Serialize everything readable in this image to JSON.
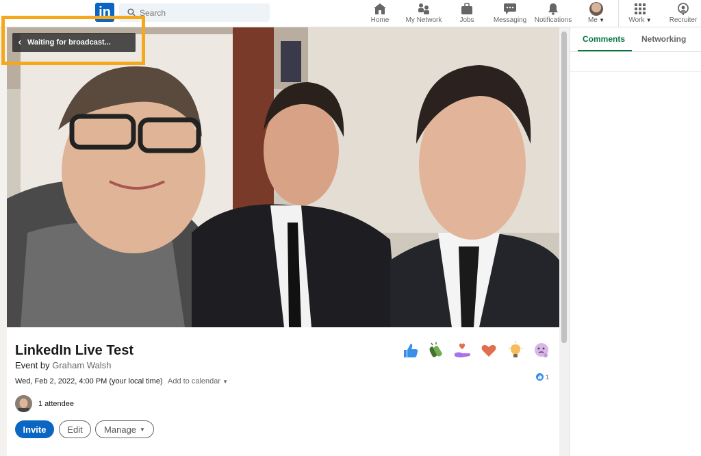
{
  "topbar": {
    "logo_text": "in",
    "search_placeholder": "Search",
    "nav": [
      {
        "label": "Home",
        "icon": "home-icon"
      },
      {
        "label": "My Network",
        "icon": "people-icon"
      },
      {
        "label": "Jobs",
        "icon": "briefcase-icon"
      },
      {
        "label": "Messaging",
        "icon": "message-icon"
      },
      {
        "label": "Notifications",
        "icon": "bell-icon"
      },
      {
        "label": "Me",
        "icon": "avatar"
      },
      {
        "label": "Work",
        "icon": "grid-icon"
      },
      {
        "label": "Recruiter",
        "icon": "recruiter-icon"
      }
    ]
  },
  "broadcast": {
    "status": "Waiting for broadcast...",
    "back_icon": "‹"
  },
  "side_panel": {
    "tabs": [
      {
        "label": "Comments",
        "active": true
      },
      {
        "label": "Networking",
        "active": false
      }
    ]
  },
  "event": {
    "title": "LinkedIn Live Test",
    "by_prefix": "Event by",
    "host": "Graham Walsh",
    "datetime": "Wed, Feb 2, 2022, 4:00 PM (your local time)",
    "calendar_label": "Add to calendar",
    "attendees": "1 attendee",
    "reaction_count": "1"
  },
  "actions": {
    "invite": "Invite",
    "edit": "Edit",
    "manage": "Manage"
  },
  "reactions": [
    "like",
    "celebrate",
    "support",
    "love",
    "insightful",
    "curious"
  ],
  "colors": {
    "brand": "#0a66c2",
    "active_tab": "#057642",
    "highlight": "#f5a81c"
  }
}
